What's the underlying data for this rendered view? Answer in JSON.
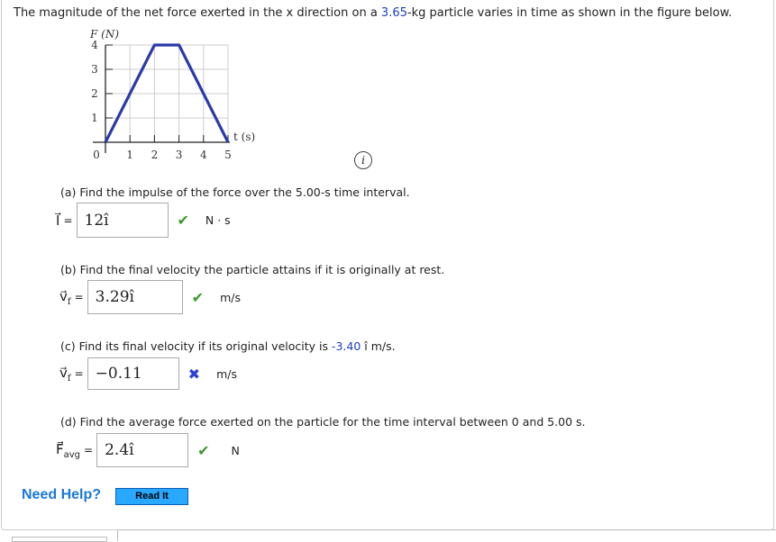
{
  "question": {
    "pre": "The magnitude of the net force exerted in the x direction on a ",
    "mass": "3.65",
    "post": "-kg particle varies in time as shown in the figure below."
  },
  "chart_data": {
    "type": "line",
    "xlabel": "t (s)",
    "ylabel": "F (N)",
    "x_ticks": [
      "0",
      "1",
      "2",
      "3",
      "4",
      "5"
    ],
    "y_ticks": [
      "1",
      "2",
      "3",
      "4"
    ],
    "xlim": [
      0,
      5
    ],
    "ylim": [
      0,
      4
    ],
    "grid": true,
    "x": [
      0,
      2,
      3,
      5
    ],
    "y": [
      0,
      4,
      4,
      0
    ],
    "color": "#2a3aa8"
  },
  "info_label": "i",
  "parts": {
    "a": {
      "text": "(a) Find the impulse of the force over the 5.00-s time interval.",
      "symbol": "I",
      "eq": "=",
      "value": "12î",
      "status": "correct",
      "unit": "N · s"
    },
    "b": {
      "text": "(b) Find the final velocity the particle attains if it is originally at rest.",
      "symbol": "v",
      "sub": "f",
      "eq": "=",
      "value": "3.29î",
      "status": "correct",
      "unit": "m/s"
    },
    "c": {
      "text_pre": "(c) Find its final velocity if its original velocity is ",
      "given": "-3.40",
      "text_post": " î m/s.",
      "symbol": "v",
      "sub": "f",
      "eq": "=",
      "value": "−0.11",
      "status": "incorrect",
      "unit": "m/s"
    },
    "d": {
      "text": "(d) Find the average force exerted on the particle for the time interval between 0 and 5.00 s.",
      "symbol": "F",
      "sub": "avg",
      "eq": "=",
      "value": "2.4î",
      "status": "correct",
      "unit": "N"
    }
  },
  "marks": {
    "correct": "✔",
    "incorrect": "✖"
  },
  "help": {
    "label": "Need Help?",
    "button": "Read It"
  }
}
